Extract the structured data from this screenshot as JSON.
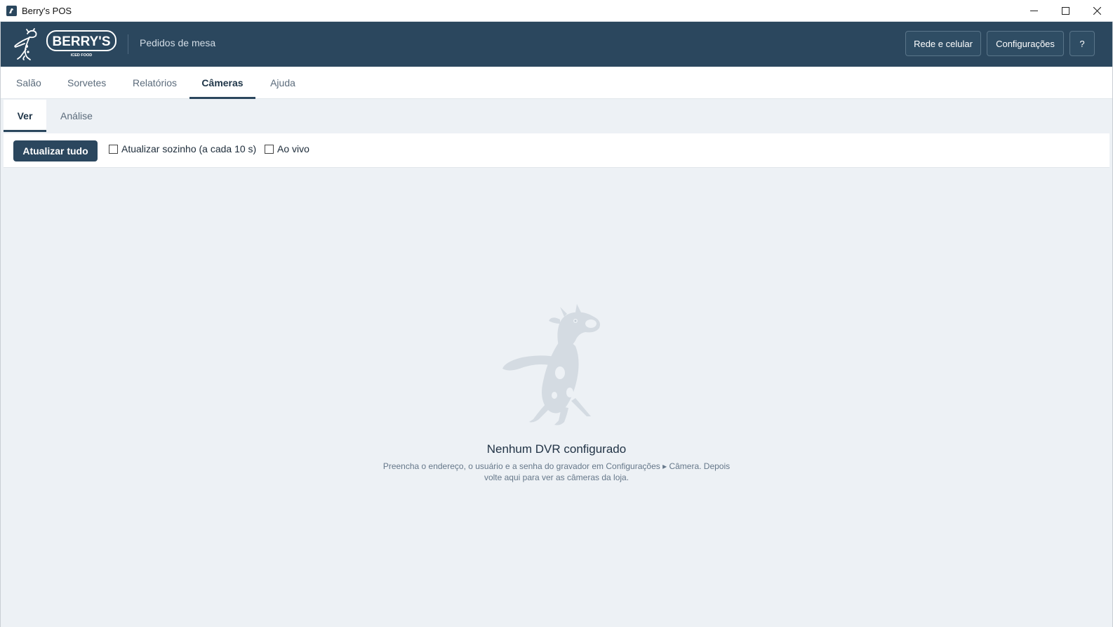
{
  "window": {
    "title": "Berry's POS"
  },
  "header": {
    "logo_text": "BERRY'S",
    "logo_subtext": "ICED FOOD",
    "subtitle": "Pedidos de mesa",
    "buttons": {
      "network": "Rede e celular",
      "settings": "Configurações",
      "help": "?"
    }
  },
  "main_tabs": [
    {
      "label": "Salão",
      "active": false
    },
    {
      "label": "Sorvetes",
      "active": false
    },
    {
      "label": "Relatórios",
      "active": false
    },
    {
      "label": "Câmeras",
      "active": true
    },
    {
      "label": "Ajuda",
      "active": false
    }
  ],
  "sub_tabs": [
    {
      "label": "Ver",
      "active": true
    },
    {
      "label": "Análise",
      "active": false
    }
  ],
  "toolbar": {
    "refresh_all": "Atualizar tudo",
    "auto_refresh_label": "Atualizar sozinho (a cada 10 s)",
    "auto_refresh_checked": false,
    "live_label": "Ao vivo",
    "live_checked": false
  },
  "empty_state": {
    "illustration": "cow-mascot-icon",
    "title": "Nenhum DVR configurado",
    "line1": "Preencha o endereço, o usuário e a senha do gravador em Configurações ▸ Câmera. Depois",
    "line2": "volte aqui para ver as câmeras da loja."
  },
  "colors": {
    "header_bg": "#2b475e",
    "page_bg": "#edf1f5",
    "accent": "#2b475e"
  }
}
